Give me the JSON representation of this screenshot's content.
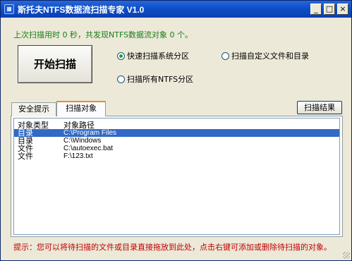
{
  "window": {
    "title": "斯托夫NTFS数据流扫描专家 V1.0",
    "controls": {
      "minimize": "_",
      "maximize": "□",
      "close": "×"
    }
  },
  "status": {
    "text": "上次扫描用时 0 秒，共发现NTFS数据流对象 0 个。"
  },
  "scan_button": {
    "label": "开始扫描"
  },
  "scan_options": [
    {
      "label": "快速扫描系统分区",
      "selected": true
    },
    {
      "label": "扫描自定义文件和目录",
      "selected": false
    },
    {
      "label": "扫描所有NTFS分区",
      "selected": false
    }
  ],
  "tabs": [
    {
      "label": "安全提示",
      "active": false
    },
    {
      "label": "扫描对象",
      "active": true
    }
  ],
  "results_button": {
    "label": "扫描结果"
  },
  "list": {
    "columns": [
      "对象类型",
      "对象路径"
    ],
    "rows": [
      {
        "type": "目录",
        "path": "C:\\Program Files",
        "selected": true
      },
      {
        "type": "目录",
        "path": "C:\\Windows",
        "selected": false
      },
      {
        "type": "文件",
        "path": "C:\\autoexec.bat",
        "selected": false
      },
      {
        "type": "文件",
        "path": "F:\\123.txt",
        "selected": false
      }
    ]
  },
  "hint": {
    "text": "提示：您可以将待扫描的文件或目录直接拖放到此处，点击右键可添加或删除待扫描的对象。"
  },
  "colors": {
    "titlebar": "#0d4fc7",
    "status_text": "#1a7d1a",
    "hint_text": "#c00000",
    "selection": "#3169c6",
    "tab_accent": "#e68b2c"
  }
}
